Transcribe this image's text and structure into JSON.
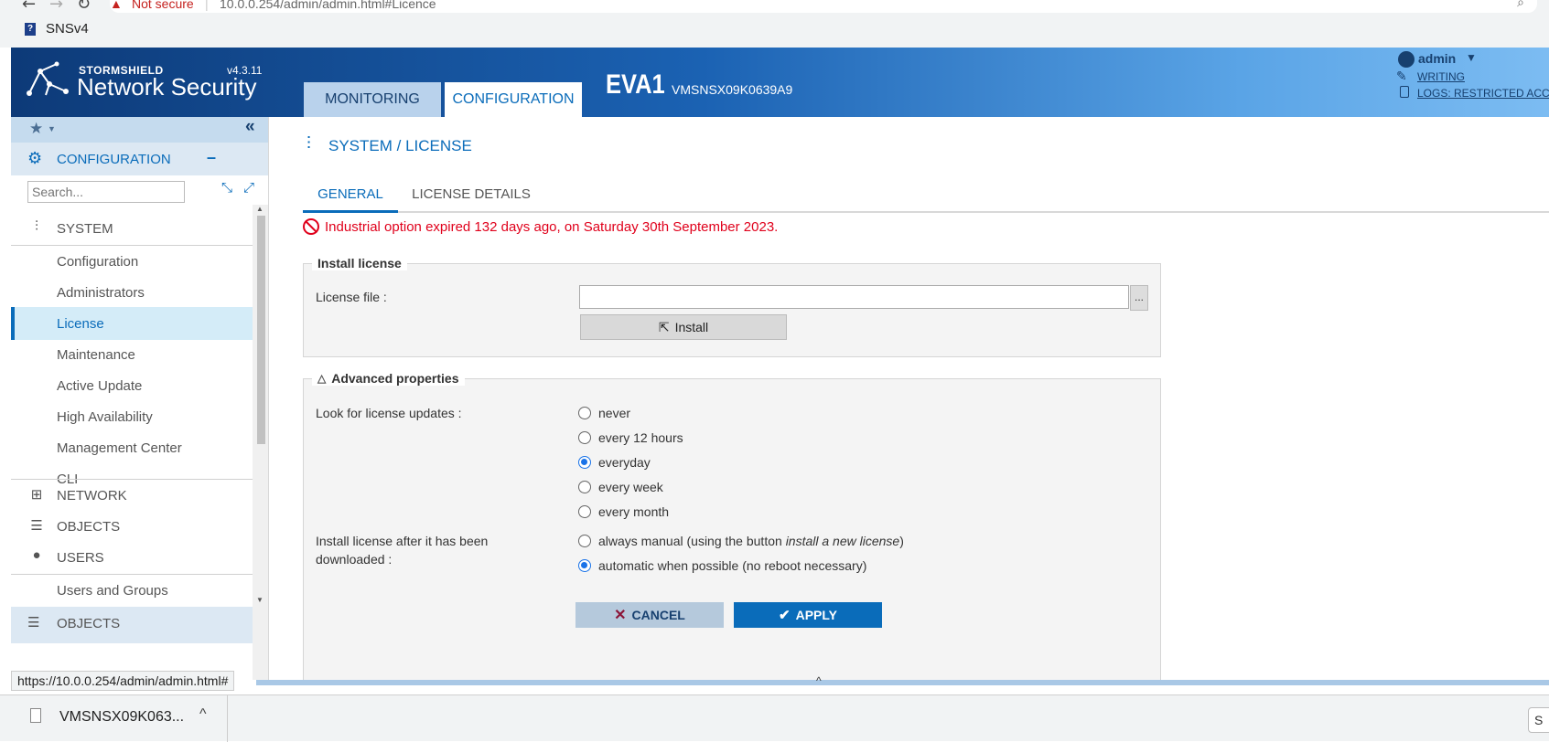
{
  "browser": {
    "security_label": "Not secure",
    "url": "10.0.0.254/admin/admin.html#Licence",
    "bookmark": "SNSv4"
  },
  "header": {
    "brand_small": "STORMSHIELD",
    "brand_large": "Network Security",
    "version": "v4.3.11",
    "tabs": [
      {
        "label": "MONITORING",
        "active": false
      },
      {
        "label": "CONFIGURATION",
        "active": true
      }
    ],
    "device_name": "EVA1",
    "serial": "VMSNSX09K0639A9",
    "user": "admin",
    "writing": "WRITING",
    "logs": "LOGS: RESTRICTED ACCE"
  },
  "sidebar": {
    "section_title": "CONFIGURATION",
    "collapse_symbol": "–",
    "search_placeholder": "Search...",
    "system_label": "SYSTEM",
    "system_items": [
      {
        "label": "Configuration",
        "active": false
      },
      {
        "label": "Administrators",
        "active": false
      },
      {
        "label": "License",
        "active": true
      },
      {
        "label": "Maintenance",
        "active": false
      },
      {
        "label": "Active Update",
        "active": false
      },
      {
        "label": "High Availability",
        "active": false
      },
      {
        "label": "Management Center",
        "active": false
      },
      {
        "label": "CLI",
        "active": false
      }
    ],
    "network_label": "NETWORK",
    "objects_label": "OBJECTS",
    "users_label": "USERS",
    "users_items": [
      "Users and Groups"
    ],
    "bottom_section": "OBJECTS"
  },
  "page": {
    "title": "SYSTEM / LICENSE",
    "tabs": [
      {
        "label": "GENERAL",
        "active": true
      },
      {
        "label": "LICENSE DETAILS",
        "active": false
      }
    ],
    "alert": "Industrial option expired 132 days ago, on Saturday 30th September 2023.",
    "install_legend": "Install license",
    "license_file_label": "License file :",
    "license_file_value": "",
    "browse_label": "...",
    "install_button": "Install",
    "advanced_legend": "Advanced properties",
    "look_for_updates_label": "Look for license updates :",
    "update_options": [
      {
        "label": "never",
        "selected": false
      },
      {
        "label": "every 12 hours",
        "selected": false
      },
      {
        "label": "everyday",
        "selected": true
      },
      {
        "label": "every week",
        "selected": false
      },
      {
        "label": "every month",
        "selected": false
      }
    ],
    "install_after_label_1": "Install license after it has been",
    "install_after_label_2": "downloaded :",
    "manual_option_prefix": "always manual (using the button ",
    "manual_option_em": "install a new license",
    "manual_option_suffix": ")",
    "manual_selected": false,
    "automatic_option": "automatic when possible (no reboot necessary)",
    "automatic_selected": true,
    "cancel_button": "CANCEL",
    "apply_button": "APPLY"
  },
  "status_url": "https://10.0.0.254/admin/admin.html#",
  "download": {
    "file_name": "VMSNSX09K063...",
    "right_button": "S"
  },
  "colors": {
    "accent": "#0a6cba",
    "alert": "#e0001b",
    "selected_row": "#d4ecf8",
    "cancel_bg": "#b5c9dc",
    "apply_bg": "#0a6cba"
  }
}
